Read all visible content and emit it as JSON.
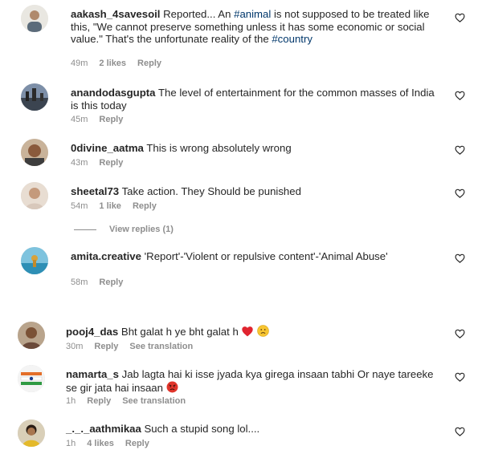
{
  "comments": [
    {
      "username": "aakash_4savesoil",
      "text_before": "Reported... An ",
      "hashtag1": "#animal",
      "text_middle": " is not supposed to be treated like this, \"We cannot preserve something unless it has some economic or social value.\" That's the unfortunate reality of the ",
      "hashtag2": "#country",
      "time": "49m",
      "likes": "2 likes",
      "reply": "Reply"
    },
    {
      "username": "anandodasgupta",
      "text": "The level of entertainment for the common masses of India is this today",
      "time": "45m",
      "reply": "Reply"
    },
    {
      "username": "0divine_aatma",
      "text": "This is wrong absolutely wrong",
      "time": "43m",
      "reply": "Reply"
    },
    {
      "username": "sheetal73",
      "text": "Take action. They Should be punished",
      "time": "54m",
      "likes": "1 like",
      "reply": "Reply"
    },
    {
      "username": "amita.creative",
      "text": "'Report'-'Violent or repulsive content'-'Animal Abuse'",
      "time": "58m",
      "reply": "Reply"
    },
    {
      "username": "pooj4_das",
      "text": "Bht galat h ye bht galat h",
      "time": "30m",
      "reply": "Reply",
      "translate": "See translation"
    },
    {
      "username": "namarta_s",
      "text": "Jab lagta hai ki isse jyada kya girega insaan tabhi Or naye tareeke se gir jata hai insaan",
      "time": "1h",
      "reply": "Reply",
      "translate": "See translation"
    },
    {
      "username": "_._._aathmikaa",
      "text": "Such a stupid song lol....",
      "time": "1h",
      "likes": "4 likes",
      "reply": "Reply"
    }
  ],
  "view_replies": "View replies (1)",
  "icons": {
    "like": "heart-outline-icon"
  },
  "colors": {
    "text": "#262626",
    "meta": "#8e8e8e",
    "hashtag": "#00376b"
  }
}
